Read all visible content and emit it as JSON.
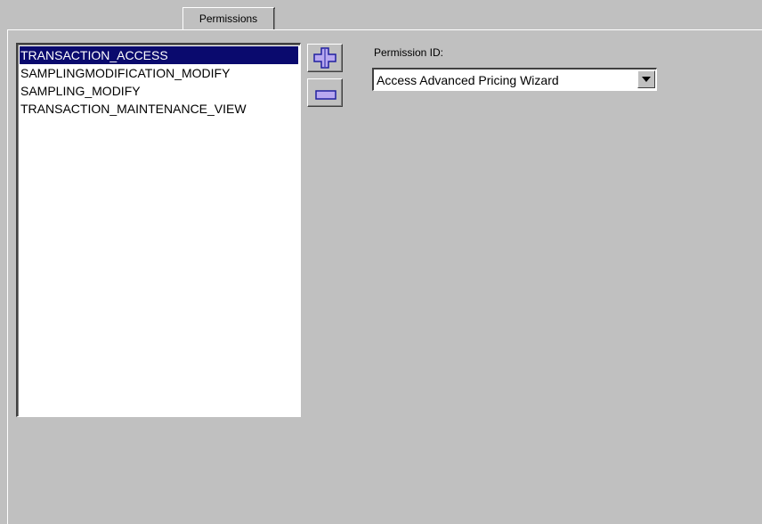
{
  "tabs": [
    {
      "label": "Permissions",
      "active": true
    }
  ],
  "permissions_list": {
    "items": [
      {
        "label": "TRANSACTION_ACCESS",
        "selected": true
      },
      {
        "label": "SAMPLINGMODIFICATION_MODIFY",
        "selected": false
      },
      {
        "label": "SAMPLING_MODIFY",
        "selected": false
      },
      {
        "label": "TRANSACTION_MAINTENANCE_VIEW",
        "selected": false
      }
    ]
  },
  "toolbar": {
    "add_icon": "plus-icon",
    "remove_icon": "minus-icon"
  },
  "permission_field": {
    "label": "Permission ID:",
    "value": "Access Advanced Pricing Wizard"
  },
  "colors": {
    "window_bg": "#c0c0c0",
    "selection_bg": "#0a0a6e",
    "icon_fill": "#b8a8f0",
    "icon_border": "#2020a0"
  }
}
